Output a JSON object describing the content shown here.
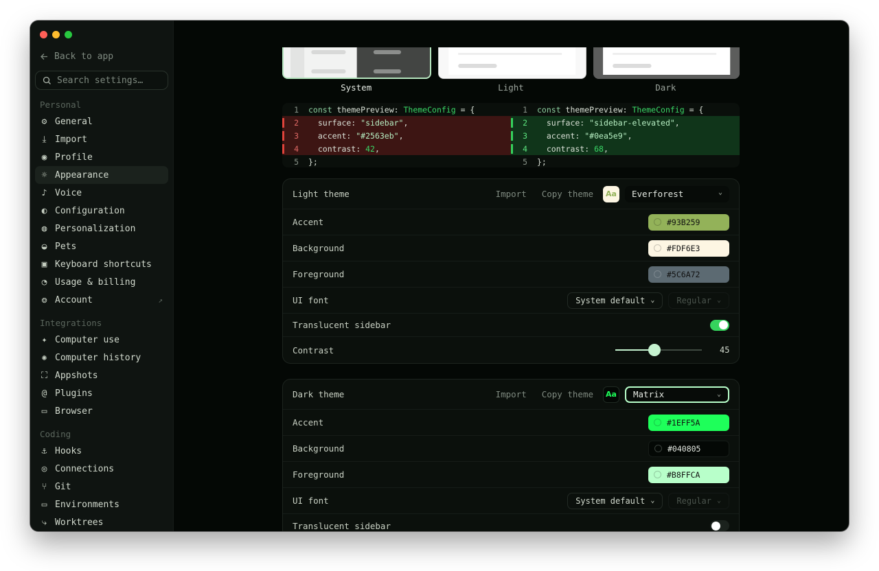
{
  "window": {
    "traffic_colors": [
      "#ff5f57",
      "#febc2e",
      "#28c840"
    ]
  },
  "sidebar": {
    "back_label": "Back to app",
    "search_placeholder": "Search settings…",
    "sections": [
      {
        "title": "Personal",
        "items": [
          {
            "label": "General",
            "icon": "gear-icon"
          },
          {
            "label": "Import",
            "icon": "download-icon"
          },
          {
            "label": "Profile",
            "icon": "user-circle-icon"
          },
          {
            "label": "Appearance",
            "icon": "sun-icon",
            "active": true
          },
          {
            "label": "Voice",
            "icon": "microphone-icon"
          },
          {
            "label": "Configuration",
            "icon": "sliders-icon"
          },
          {
            "label": "Personalization",
            "icon": "palette-icon"
          },
          {
            "label": "Pets",
            "icon": "paw-icon"
          },
          {
            "label": "Keyboard shortcuts",
            "icon": "keyboard-icon"
          },
          {
            "label": "Usage & billing",
            "icon": "gauge-icon"
          },
          {
            "label": "Account",
            "icon": "account-icon",
            "external": true
          }
        ]
      },
      {
        "title": "Integrations",
        "items": [
          {
            "label": "Computer use",
            "icon": "pointer-icon"
          },
          {
            "label": "Computer history",
            "icon": "history-icon"
          },
          {
            "label": "Appshots",
            "icon": "screenshot-icon"
          },
          {
            "label": "Plugins",
            "icon": "plugin-icon"
          },
          {
            "label": "Browser",
            "icon": "browser-icon"
          }
        ]
      },
      {
        "title": "Coding",
        "items": [
          {
            "label": "Hooks",
            "icon": "anchor-icon"
          },
          {
            "label": "Connections",
            "icon": "globe-icon"
          },
          {
            "label": "Git",
            "icon": "git-icon"
          },
          {
            "label": "Environments",
            "icon": "monitor-icon"
          },
          {
            "label": "Worktrees",
            "icon": "worktree-icon"
          }
        ]
      }
    ]
  },
  "theme_modes": [
    {
      "label": "System",
      "selected": true
    },
    {
      "label": "Light",
      "selected": false
    },
    {
      "label": "Dark",
      "selected": false
    }
  ],
  "diff": {
    "left": [
      {
        "n": "1",
        "code": "const themePreview: ThemeConfig = {",
        "changed": false
      },
      {
        "n": "2",
        "code": "  surface: \"sidebar\",",
        "changed": true
      },
      {
        "n": "3",
        "code": "  accent: \"#2563eb\",",
        "changed": true
      },
      {
        "n": "4",
        "code": "  contrast: 42,",
        "changed": true
      },
      {
        "n": "5",
        "code": "};",
        "changed": false
      }
    ],
    "right": [
      {
        "n": "1",
        "code": "const themePreview: ThemeConfig = {",
        "changed": false
      },
      {
        "n": "2",
        "code": "  surface: \"sidebar-elevated\",",
        "changed": true
      },
      {
        "n": "3",
        "code": "  accent: \"#0ea5e9\",",
        "changed": true
      },
      {
        "n": "4",
        "code": "  contrast: 68,",
        "changed": true
      },
      {
        "n": "5",
        "code": "};",
        "changed": false
      }
    ]
  },
  "light_theme": {
    "title": "Light theme",
    "import_label": "Import",
    "copy_label": "Copy theme",
    "aa_label": "Aa",
    "preset": "Everforest",
    "accent_label": "Accent",
    "accent": "#93B259",
    "background_label": "Background",
    "background": "#FDF6E3",
    "foreground_label": "Foreground",
    "foreground": "#5C6A72",
    "ui_font_label": "UI font",
    "ui_font": "System default",
    "ui_weight": "Regular",
    "translucent_label": "Translucent sidebar",
    "translucent": true,
    "contrast_label": "Contrast",
    "contrast": "45"
  },
  "dark_theme": {
    "title": "Dark theme",
    "import_label": "Import",
    "copy_label": "Copy theme",
    "aa_label": "Aa",
    "preset": "Matrix",
    "accent_label": "Accent",
    "accent": "#1EFF5A",
    "background_label": "Background",
    "background": "#040805",
    "foreground_label": "Foreground",
    "foreground": "#B8FFCA",
    "ui_font_label": "UI font",
    "ui_font": "System default",
    "ui_weight": "Regular",
    "translucent_label": "Translucent sidebar",
    "translucent": false
  }
}
